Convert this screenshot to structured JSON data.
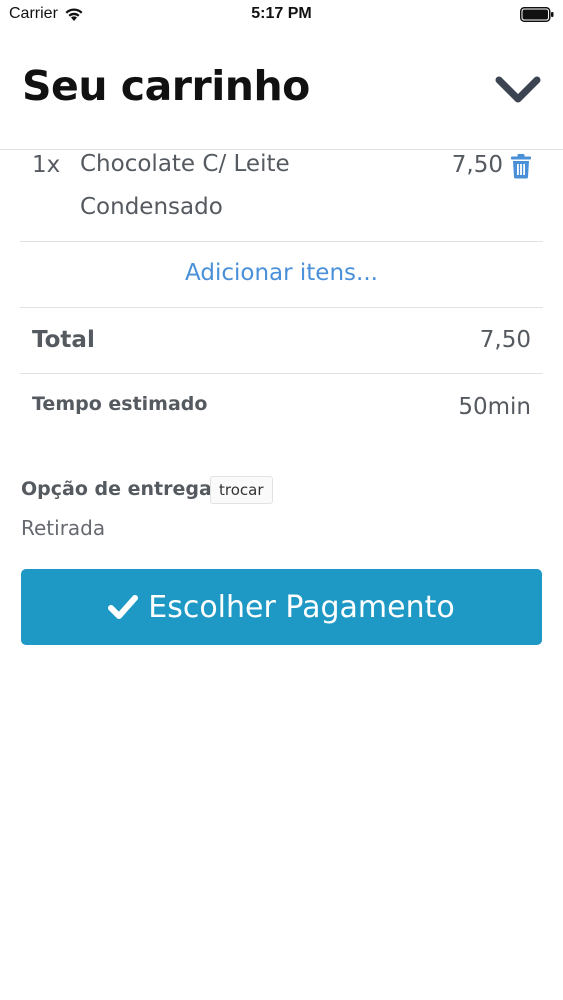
{
  "status_bar": {
    "carrier": "Carrier",
    "time": "5:17 PM"
  },
  "header": {
    "title": "Seu carrinho"
  },
  "cart": {
    "items": [
      {
        "qty": "1x",
        "name": "Chocolate C/ Leite Condensado",
        "price": "7,50"
      }
    ],
    "add_items_label": "Adicionar itens...",
    "total_label": "Total",
    "total_value": "7,50",
    "estimated_time_label": "Tempo estimado",
    "estimated_time_value": "50min"
  },
  "delivery": {
    "label": "Opção de entrega",
    "change_label": "trocar",
    "value": "Retirada"
  },
  "payment_button": {
    "label": "Escolher Pagamento"
  },
  "colors": {
    "link": "#4a90d9",
    "button": "#1e98c4",
    "text": "#555a60"
  }
}
